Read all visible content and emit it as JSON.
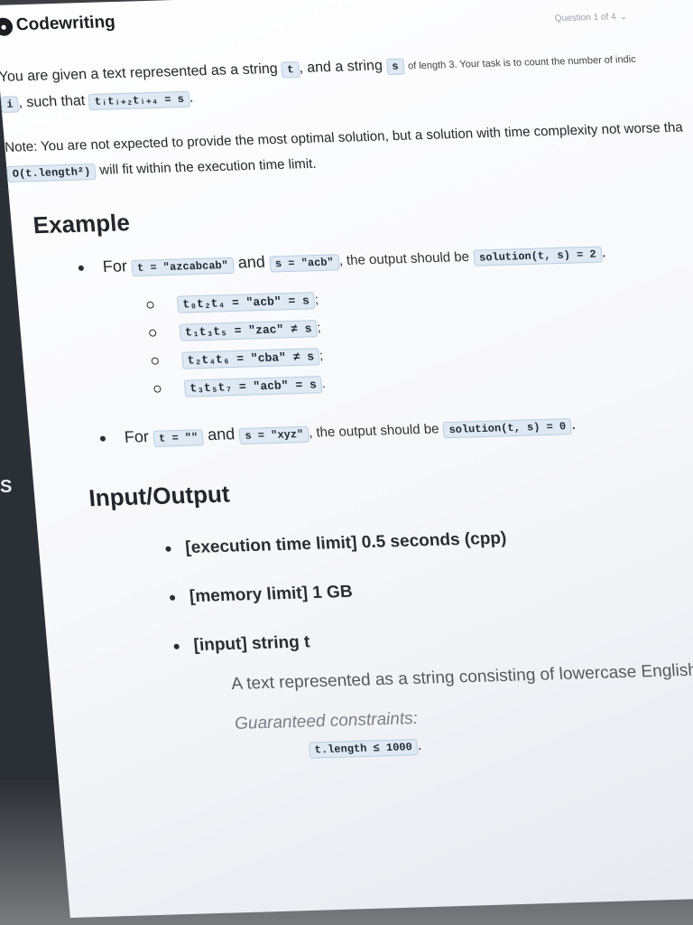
{
  "app": {
    "title": "Codewriting",
    "question_counter": "Question 1 of 4"
  },
  "side_label": "S",
  "statement": {
    "line1_a": "You are given a text represented as a string",
    "t_var": "t",
    "line1_b": ", and a string",
    "s_var": "s",
    "line1_c": "of length 3. Your task is to count the number of indic",
    "i_var": "i",
    "line2_a": ", such that",
    "condition": "tᵢtᵢ₊₂tᵢ₊₄ = s",
    "line2_b": "."
  },
  "note": {
    "text_a": "Note: You are not expected to provide the most optimal solution, but a solution with time complexity not worse tha",
    "complexity": "O(t.length²)",
    "text_b": "will fit within the execution time limit."
  },
  "example": {
    "title": "Example",
    "item1": {
      "for": "For",
      "t": "t = \"azcabcab\"",
      "and": "and",
      "s": "s = \"acb\"",
      "output_text": ", the output should be",
      "output": "solution(t, s) = 2",
      "end": "."
    },
    "subitems": [
      {
        "expr": "t₀t₂t₄ = \"acb\" = s",
        "end": ";"
      },
      {
        "expr": "t₁t₃t₅ = \"zac\" ≠ s",
        "end": ";"
      },
      {
        "expr": "t₂t₄t₆ = \"cba\" ≠ s",
        "end": ";"
      },
      {
        "expr": "t₃t₅t₇ = \"acb\" = s",
        "end": "."
      }
    ],
    "item2": {
      "for": "For",
      "t": "t = \"\"",
      "and": "and",
      "s": "s = \"xyz\"",
      "output_text": ", the output should be",
      "output": "solution(t, s) = 0",
      "end": "."
    }
  },
  "io": {
    "title": "Input/Output",
    "time_limit": "[execution time limit] 0.5 seconds (cpp)",
    "memory_limit": "[memory limit] 1 GB",
    "input": "[input] string t",
    "input_desc": "A text represented as a string consisting of lowercase English letters.",
    "constraints_label": "Guaranteed constraints:",
    "constraint": "t.length ≤ 1000",
    "constraint_end": "."
  }
}
